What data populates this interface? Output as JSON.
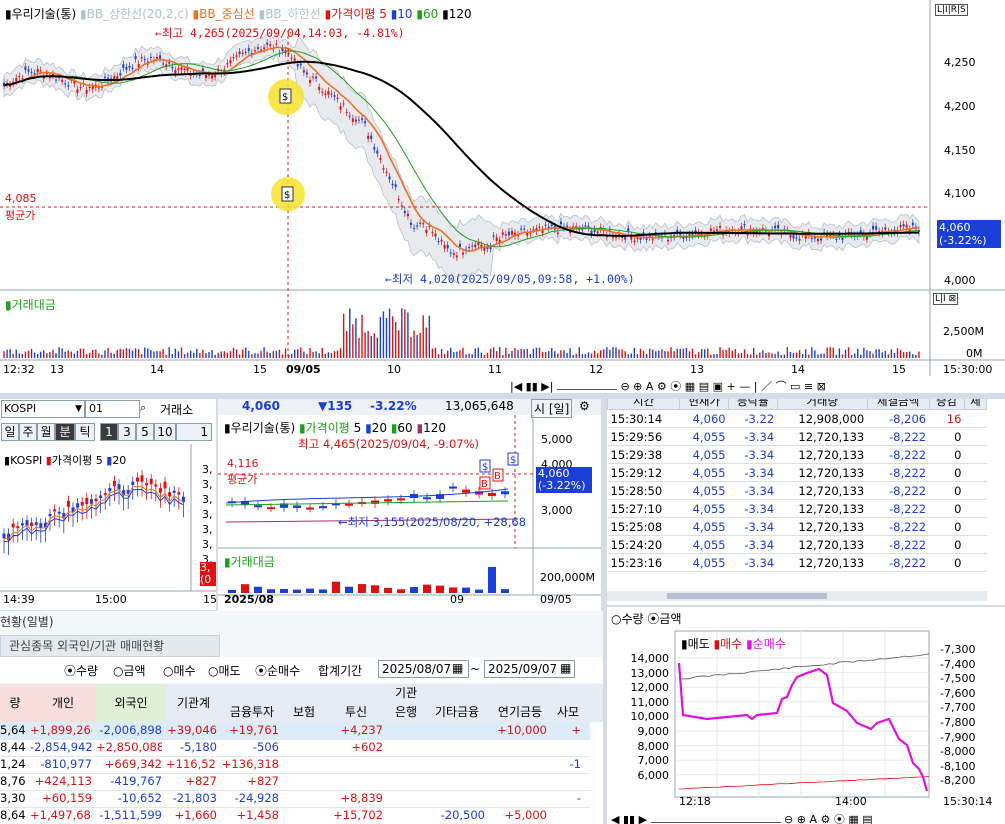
{
  "main_chart": {
    "legend_title": "우리기술(통)",
    "legend_bb_upper": "BB_상한선(20,2,c)",
    "legend_bb_mid": "BB_중심선",
    "legend_bb_lower": "BB_하한선",
    "legend_ma": "가격이평",
    "ma5": "5",
    "ma10": "10",
    "ma60": "60",
    "ma120": "120",
    "high_label": "←최고 4,265(2025/09/04,14:03, -4.81%)",
    "low_label": "←최저 4,020(2025/09/05,09:58, +1.00%)",
    "avg_price_value": "4,085",
    "avg_price_label": "평균가",
    "cur_price": "4,060",
    "cur_change": "(-3.22%)",
    "y_ticks": [
      "4,250",
      "4,200",
      "4,150",
      "4,100",
      "4,050",
      "4,000"
    ],
    "volume_title": "거래대금",
    "vol_ticks": [
      "2,500M",
      "0M"
    ],
    "x_ticks": [
      "12:32",
      "13",
      "14",
      "15",
      "09/05",
      "10",
      "11",
      "12",
      "13",
      "14",
      "15"
    ],
    "end_time": "15:30:00",
    "lirs": "L|I|R|S"
  },
  "kospi_panel": {
    "market": "KOSPI",
    "code": "01",
    "exchange": "거래소",
    "periods": [
      "일",
      "주",
      "월",
      "분",
      "틱",
      "1",
      "3",
      "5",
      "10",
      "1"
    ],
    "active_period": "분",
    "active_num": "1",
    "legend_name": "KOSPI",
    "legend_ma": "가격이평",
    "ma5": "5",
    "ma20": "20",
    "x_ticks": [
      "14:39",
      "15:00",
      "15"
    ],
    "right_ticks": [
      "3,",
      "3,",
      "3,",
      "3,",
      "3,",
      "3,",
      "3,"
    ],
    "badge": [
      "3,",
      "(0"
    ]
  },
  "daily_chart": {
    "price": "4,060",
    "change": "▼135",
    "pct": "-3.22%",
    "volume": "13,065,648",
    "period": "시 [일]",
    "legend_title": "우리기술(통)",
    "legend_ma": "가격이평",
    "ma5": "5",
    "ma20": "20",
    "ma60": "60",
    "ma120": "120",
    "high_label": "최고 4,465(2025/09/04, -9.07%)",
    "low_label": "←최저 3,155(2025/08/20, +28,68",
    "avg_value": "4,116",
    "avg_label": "평균가",
    "y_ticks": [
      "5,000",
      "4,000",
      "3,000"
    ],
    "cur_price": "4,060",
    "cur_change": "(-3.22%)",
    "volume_title": "거래대금",
    "vol_tick": "200,000M",
    "x_ticks": [
      "2025/08",
      "09",
      "09/05"
    ]
  },
  "trades": {
    "headers": [
      "시간",
      "현재가",
      "등락률",
      "거래량",
      "체결금액",
      "증감",
      "체"
    ],
    "rows": [
      [
        "15:30:14",
        "4,060",
        "-3.22",
        "12,908,000",
        "-8,206",
        "16"
      ],
      [
        "15:29:56",
        "4,055",
        "-3.34",
        "12,720,133",
        "-8,222",
        "0"
      ],
      [
        "15:29:38",
        "4,055",
        "-3.34",
        "12,720,133",
        "-8,222",
        "0"
      ],
      [
        "15:29:12",
        "4,055",
        "-3.34",
        "12,720,133",
        "-8,222",
        "0"
      ],
      [
        "15:28:50",
        "4,055",
        "-3.34",
        "12,720,133",
        "-8,222",
        "0"
      ],
      [
        "15:27:10",
        "4,055",
        "-3.34",
        "12,720,133",
        "-8,222",
        "0"
      ],
      [
        "15:25:08",
        "4,055",
        "-3.34",
        "12,720,133",
        "-8,222",
        "0"
      ],
      [
        "15:24:20",
        "4,055",
        "-3.34",
        "12,720,133",
        "-8,222",
        "0"
      ],
      [
        "15:23:16",
        "4,055",
        "-3.34",
        "12,720,133",
        "-8,222",
        "0"
      ]
    ]
  },
  "investor_chart": {
    "radio_qty": "수량",
    "radio_amt": "금액",
    "legend_sell": "매도",
    "legend_buy": "매수",
    "legend_net": "순매수",
    "left_ticks": [
      "14,000",
      "13,000",
      "12,000",
      "11,000",
      "10,000",
      "9,000",
      "8,000",
      "7,000",
      "6,000"
    ],
    "right_ticks": [
      "-7,300",
      "-7,400",
      "-7,500",
      "-7,600",
      "-7,700",
      "-7,800",
      "-7,900",
      "-8,000",
      "-8,100",
      "-8,200"
    ],
    "x_ticks": [
      "12:18",
      "14:00",
      "15:30:14"
    ]
  },
  "investor_table": {
    "section_title": "현황(일별)",
    "tab_label": "관심종목 외국인/기관 매매현황",
    "radio_qty": "수량",
    "radio_amt": "금액",
    "radio_sell": "매수",
    "radio_buy": "매도",
    "radio_net": "순매수",
    "period_label": "합계기간",
    "date_from": "2025/08/07",
    "date_sep": "~",
    "date_to": "2025/09/07",
    "group_header": "기관",
    "headers": [
      "량",
      "개인",
      "외국인",
      "기관계",
      "금융투자",
      "보험",
      "투신",
      "은행",
      "기타금융",
      "연기금등",
      "사모"
    ],
    "rows": [
      [
        "5,648",
        "+1,899,264",
        "-2,006,898",
        "+39,046",
        "+19,761",
        "",
        "+4,237",
        "",
        "",
        "+10,000",
        "+"
      ],
      [
        "8,440",
        "-2,854,942",
        "+2,850,088",
        "-5,180",
        "-506",
        "",
        "+602",
        "",
        "",
        "",
        ""
      ],
      [
        "1,248",
        "-810,977",
        "+669,342",
        "+116,527",
        "+136,318",
        "",
        "",
        "",
        "",
        "",
        "-1"
      ],
      [
        "8,763",
        "+424,113",
        "-419,767",
        "+827",
        "+827",
        "",
        "",
        "",
        "",
        "",
        ""
      ],
      [
        "3,300",
        "+60,159",
        "-10,652",
        "-21,803",
        "-24,928",
        "",
        "+8,839",
        "",
        "",
        "",
        "-"
      ],
      [
        "8,648",
        "+1,497,688",
        "-1,511,599",
        "+1,660",
        "+1,458",
        "",
        "+15,702",
        "",
        "-20,500",
        "+5,000",
        ""
      ]
    ]
  }
}
